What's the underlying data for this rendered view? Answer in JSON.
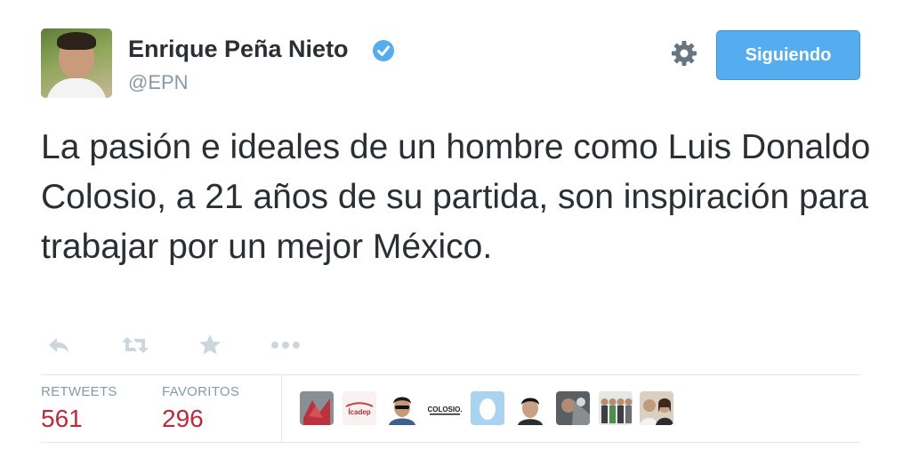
{
  "author": {
    "name": "Enrique Peña Nieto",
    "handle": "@EPN",
    "verified": true
  },
  "header": {
    "follow_button_label": "Siguiendo",
    "settings_icon": "gear-icon"
  },
  "tweet": {
    "text": "La pasión e ideales de un hombre como Luis Donaldo Colosio, a 21 años de su partida, son inspiración para trabajar por un mejor México."
  },
  "actions": [
    {
      "name": "reply",
      "icon": "reply-icon"
    },
    {
      "name": "retweet",
      "icon": "retweet-icon"
    },
    {
      "name": "favorite",
      "icon": "star-icon"
    },
    {
      "name": "more",
      "icon": "more-icon"
    }
  ],
  "stats": {
    "retweets_label": "RETWEETS",
    "retweets_value": "561",
    "favorites_label": "FAVORITOS",
    "favorites_value": "296"
  },
  "favoriters": {
    "badges": [
      "Ícadep",
      "COLOSIO."
    ]
  },
  "colors": {
    "accent": "#55acee",
    "stat_value": "#c0283a",
    "muted": "#8899a6",
    "text": "#292f33"
  }
}
